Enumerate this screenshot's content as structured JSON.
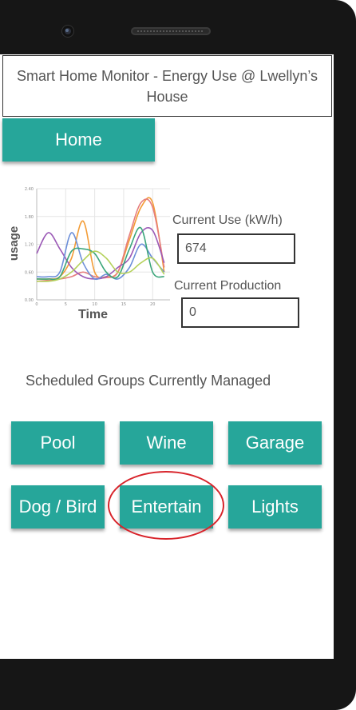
{
  "app": {
    "title": "Smart Home Monitor - Energy Use @ Lwellyn’s House"
  },
  "nav": {
    "home_label": "Home"
  },
  "readouts": {
    "current_use_label": "Current Use (kW/h)",
    "current_use_value": "674",
    "current_production_label": "Current Production",
    "current_production_value": "0"
  },
  "groups": {
    "title": "Scheduled Groups Currently Managed",
    "items": [
      {
        "label": "Pool"
      },
      {
        "label": "Wine"
      },
      {
        "label": "Garage"
      },
      {
        "label": "Dog / Bird"
      },
      {
        "label": "Entertain"
      },
      {
        "label": "Lights"
      }
    ],
    "highlighted": "Entertain"
  },
  "chart_data": {
    "type": "line",
    "xlabel": "Time",
    "ylabel": "usage",
    "x": [
      0,
      2,
      4,
      6,
      8,
      10,
      12,
      14,
      16,
      18,
      20,
      22
    ],
    "xticks": [
      "0",
      "5",
      "10",
      "15",
      "20"
    ],
    "yticks": [
      "0.00",
      "0.60",
      "1.20",
      "1.80",
      "2.40"
    ],
    "xlim": [
      0,
      23
    ],
    "ylim": [
      0,
      2.4
    ],
    "grid": true,
    "series": [
      {
        "color": "#f39c36",
        "values": [
          0.45,
          0.45,
          0.5,
          0.9,
          1.7,
          0.6,
          0.5,
          0.6,
          1.3,
          2.0,
          2.1,
          0.6
        ]
      },
      {
        "color": "#e67e7e",
        "values": [
          0.4,
          0.42,
          0.45,
          0.5,
          0.6,
          0.5,
          0.48,
          0.6,
          1.4,
          2.1,
          2.0,
          0.7
        ]
      },
      {
        "color": "#9b59b6",
        "values": [
          1.0,
          1.45,
          1.1,
          0.7,
          0.5,
          0.45,
          0.5,
          0.7,
          0.9,
          1.45,
          1.5,
          0.8
        ]
      },
      {
        "color": "#6c8fd9",
        "values": [
          0.5,
          0.5,
          0.6,
          1.45,
          0.8,
          0.45,
          0.55,
          0.45,
          0.7,
          1.2,
          0.9,
          0.6
        ]
      },
      {
        "color": "#3aa57a",
        "values": [
          0.45,
          0.45,
          0.5,
          1.05,
          1.1,
          1.0,
          0.6,
          0.5,
          1.1,
          1.55,
          0.6,
          0.5
        ]
      },
      {
        "color": "#b4d15a",
        "values": [
          0.4,
          0.4,
          0.45,
          0.6,
          0.85,
          1.05,
          0.9,
          0.6,
          0.6,
          0.8,
          0.9,
          0.55
        ]
      }
    ]
  }
}
